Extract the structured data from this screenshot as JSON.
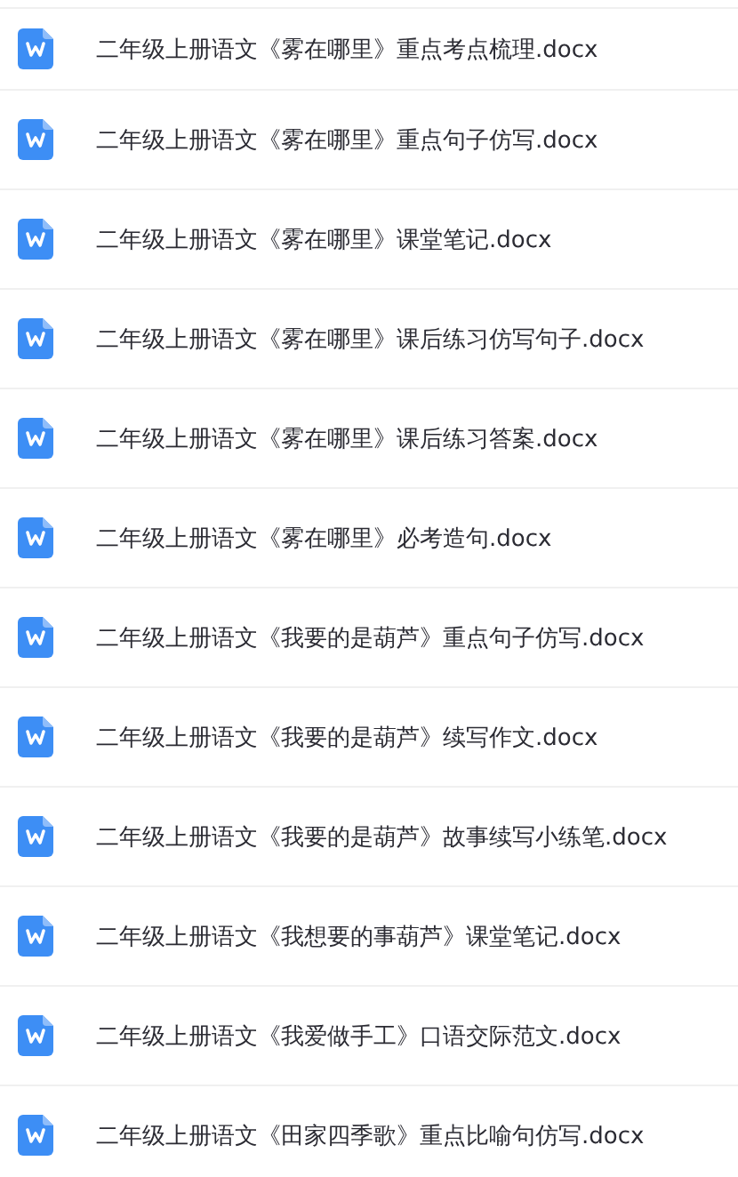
{
  "files": [
    {
      "name": "二年级上册语文《雾在哪里》重点考点梳理.docx"
    },
    {
      "name": "二年级上册语文《雾在哪里》重点句子仿写.docx"
    },
    {
      "name": "二年级上册语文《雾在哪里》课堂笔记.docx"
    },
    {
      "name": "二年级上册语文《雾在哪里》课后练习仿写句子.docx"
    },
    {
      "name": "二年级上册语文《雾在哪里》课后练习答案.docx"
    },
    {
      "name": "二年级上册语文《雾在哪里》必考造句.docx"
    },
    {
      "name": "二年级上册语文《我要的是葫芦》重点句子仿写.docx"
    },
    {
      "name": "二年级上册语文《我要的是葫芦》续写作文.docx"
    },
    {
      "name": "二年级上册语文《我要的是葫芦》故事续写小练笔.docx"
    },
    {
      "name": "二年级上册语文《我想要的事葫芦》课堂笔记.docx"
    },
    {
      "name": "二年级上册语文《我爱做手工》口语交际范文.docx"
    },
    {
      "name": "二年级上册语文《田家四季歌》重点比喻句仿写.docx"
    }
  ]
}
